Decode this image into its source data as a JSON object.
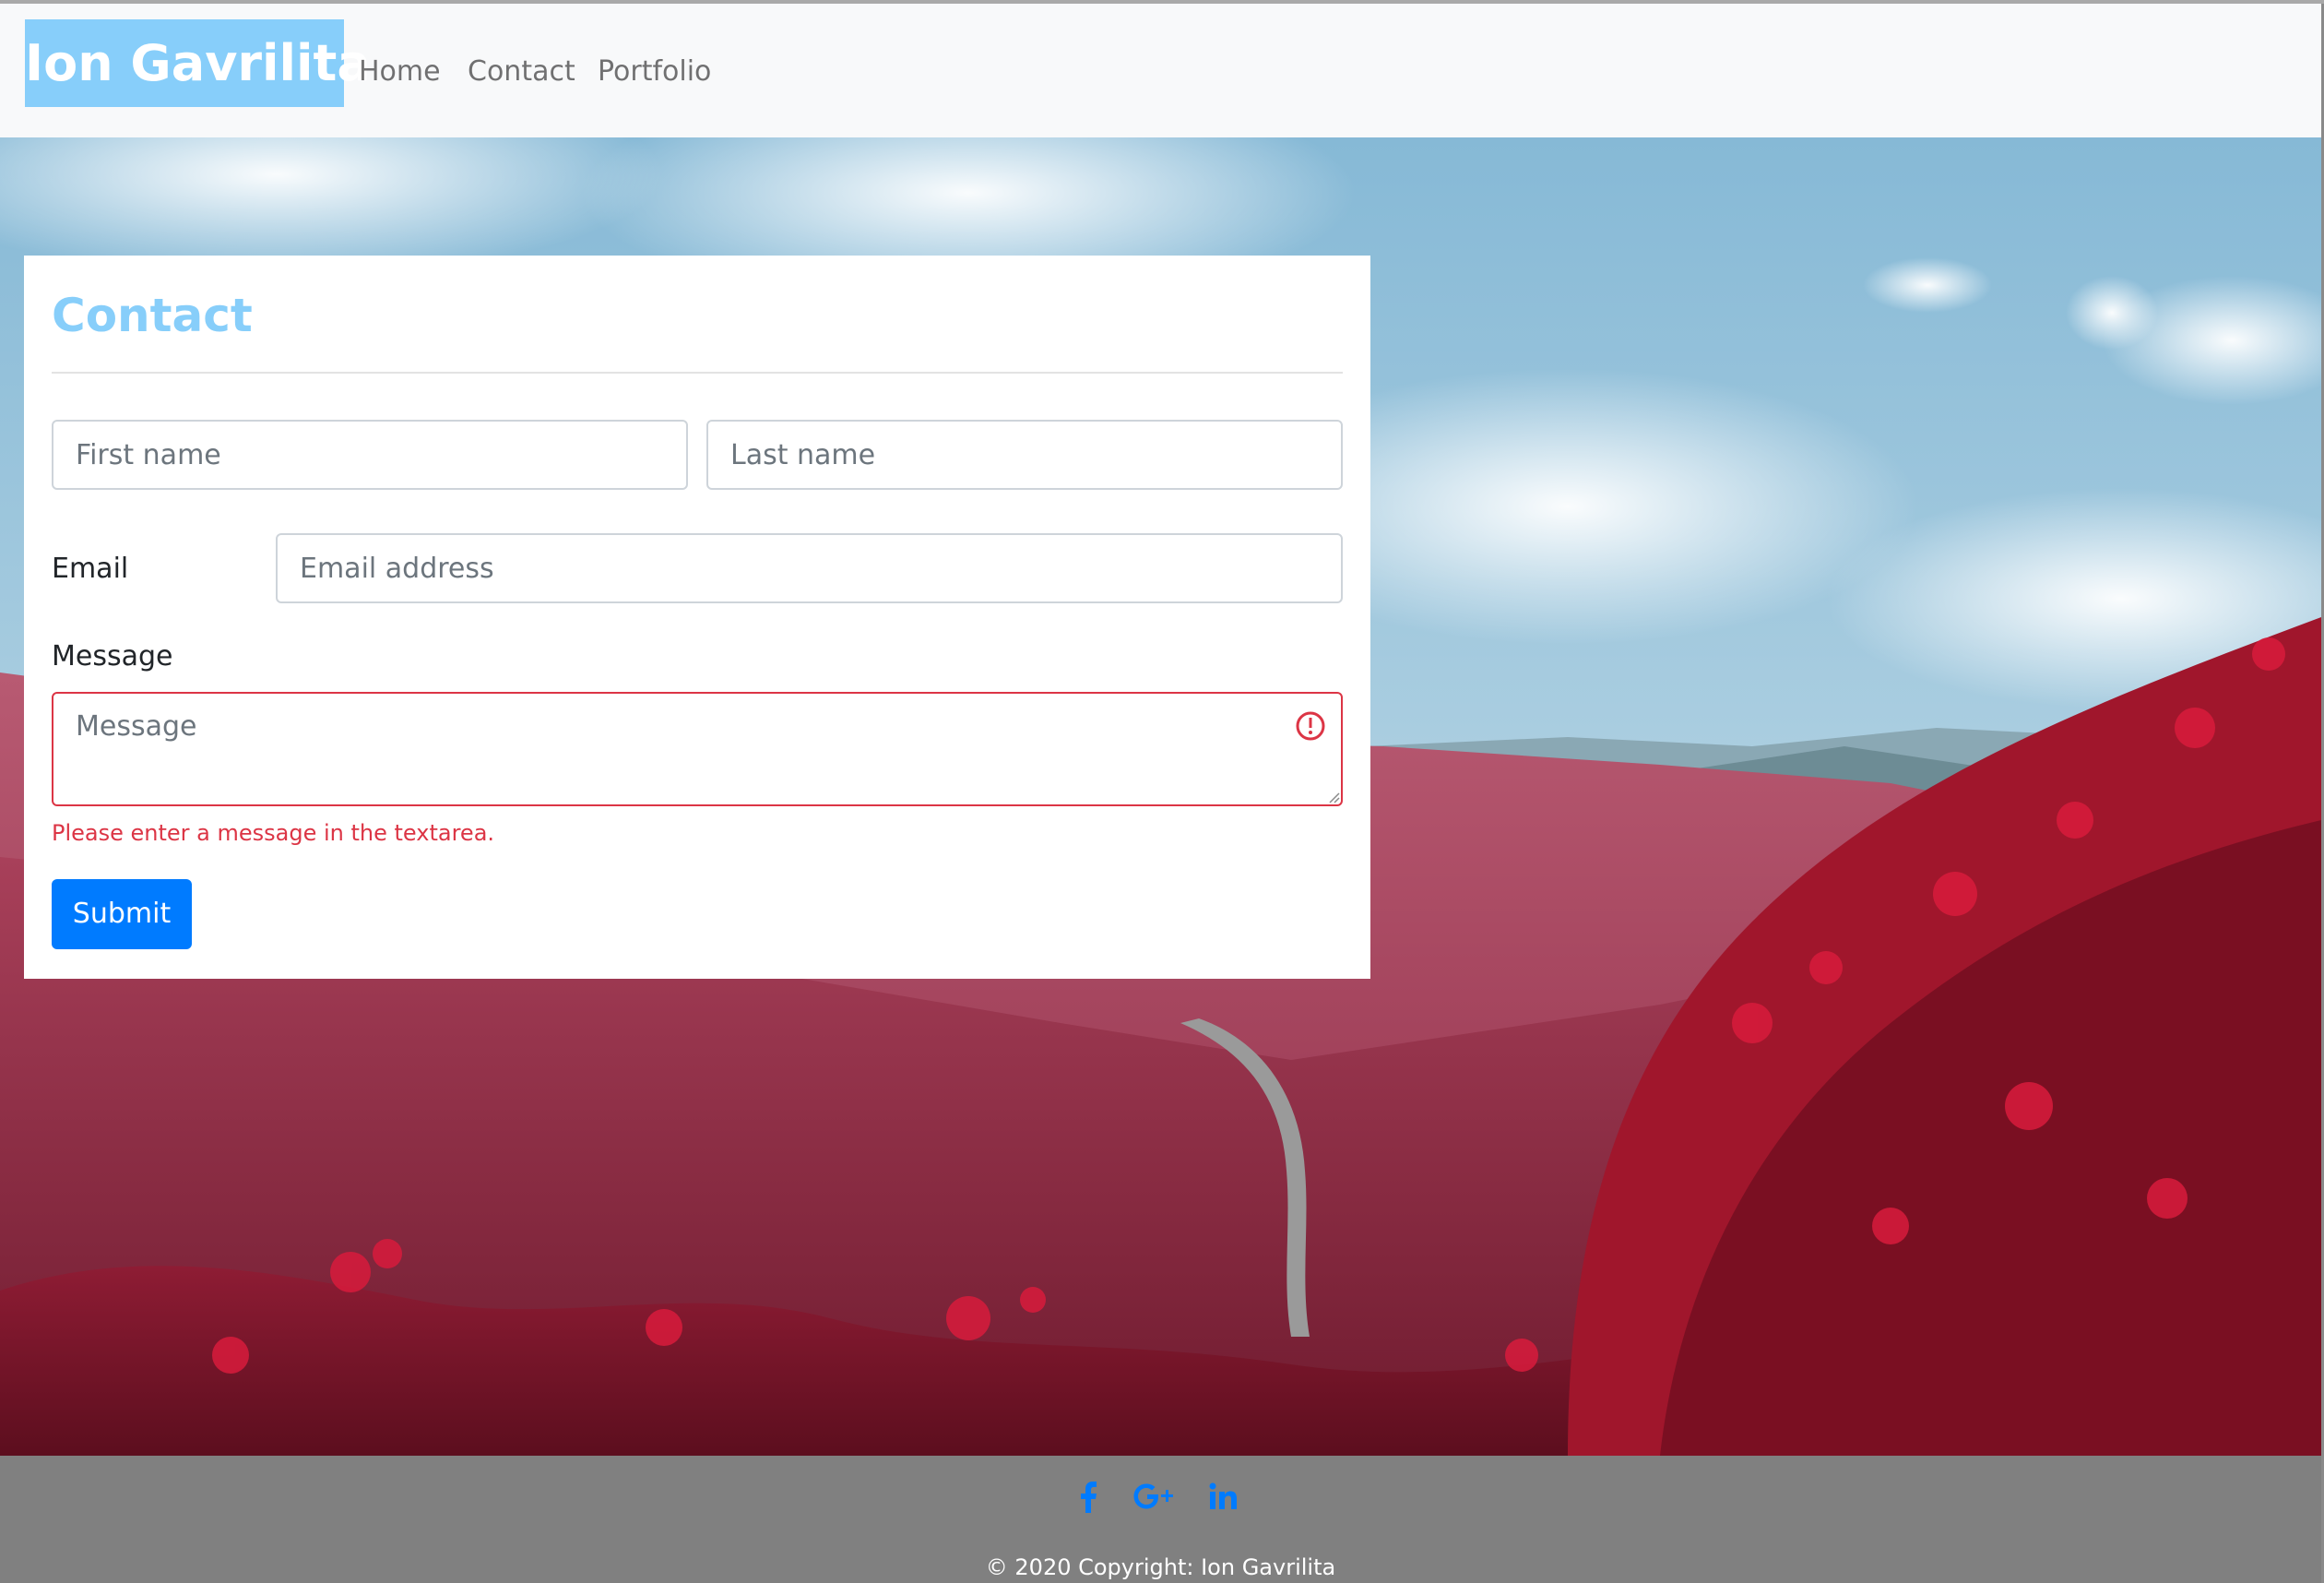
{
  "navbar": {
    "brand": "Ion Gavrilita",
    "links": [
      {
        "label": "Home"
      },
      {
        "label": "Contact"
      },
      {
        "label": "Portfolio"
      }
    ]
  },
  "contact_form": {
    "title": "Contact",
    "first_name": {
      "value": "",
      "placeholder": "First name"
    },
    "last_name": {
      "value": "",
      "placeholder": "Last name"
    },
    "email": {
      "label": "Email",
      "value": "",
      "placeholder": "Email address"
    },
    "message": {
      "label": "Message",
      "value": "",
      "placeholder": "Message",
      "state": "invalid"
    },
    "error_text": "Please enter a message in the textarea.",
    "submit_label": "Submit"
  },
  "footer": {
    "social_icons": [
      "facebook-icon",
      "google-plus-icon",
      "linkedin-icon"
    ],
    "copyright": "© 2020 Copyright: Ion Gavrilita"
  },
  "colors": {
    "brand_background": "#87cefa",
    "title_color": "#87cefa",
    "primary_button": "#007bff",
    "error": "#dc3545",
    "footer_background": "#808080",
    "social_icon": "#007bff"
  }
}
